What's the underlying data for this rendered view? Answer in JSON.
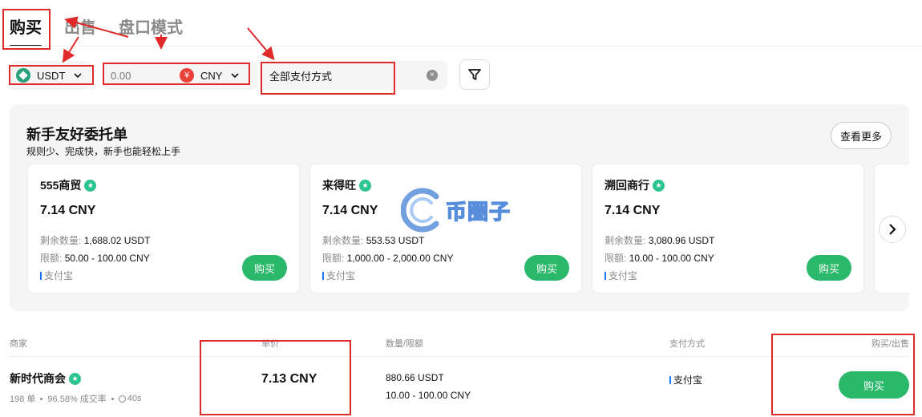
{
  "tabs": [
    {
      "label": "购买",
      "active": true
    },
    {
      "label": "出售",
      "active": false
    },
    {
      "label": "盘口模式",
      "active": false
    }
  ],
  "filters": {
    "coin": "USDT",
    "amount_placeholder": "0.00",
    "fiat_symbol": "¥",
    "fiat": "CNY",
    "payment": "全部支付方式"
  },
  "newbie": {
    "title": "新手友好委托单",
    "subtitle": "规则少、完成快，新手也能轻松上手",
    "see_more": "查看更多",
    "qty_label": "剩余数量:",
    "limit_label": "限额:",
    "buy_label": "购买",
    "cards": [
      {
        "merchant": "555商贸",
        "price": "7.14 CNY",
        "qty": "1,688.02 USDT",
        "limit": "50.00 - 100.00 CNY",
        "payment": "支付宝"
      },
      {
        "merchant": "来得旺",
        "price": "7.14 CNY",
        "qty": "553.53 USDT",
        "limit": "1,000.00 - 2,000.00 CNY",
        "payment": "支付宝"
      },
      {
        "merchant": "溯回商行",
        "price": "7.14 CNY",
        "qty": "3,080.96 USDT",
        "limit": "10.00 - 100.00 CNY",
        "payment": "支付宝"
      }
    ]
  },
  "table": {
    "headers": {
      "merchant": "商家",
      "price": "单价",
      "qty": "数量/限额",
      "payment": "支付方式",
      "action": "购买/出售"
    },
    "rows": [
      {
        "merchant": "新时代商会",
        "orders": "198 单",
        "rate": "96.58% 成交率",
        "time": "40s",
        "price": "7.13 CNY",
        "qty": "880.66 USDT",
        "limit": "10.00 - 100.00 CNY",
        "payment": "支付宝",
        "action": "购买"
      }
    ]
  },
  "watermark": {
    "text": "币圈子"
  },
  "colors": {
    "accent_green": "#2ab86b",
    "annotation_red": "#e02a2a",
    "usdt": "#26a17b",
    "cny": "#e8413a",
    "verified": "#2cc48f"
  }
}
